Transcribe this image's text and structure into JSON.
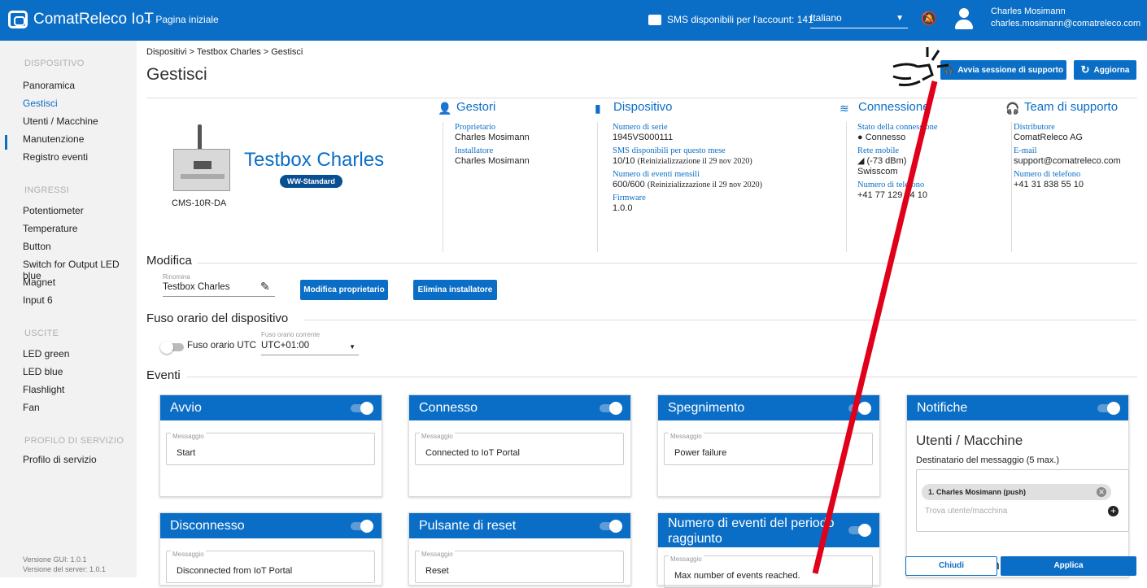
{
  "app": {
    "name": "ComatReleco IoT",
    "home_link": "← Pagina iniziale",
    "sms_text": "SMS disponibili per l'account: 141",
    "language": "Italiano",
    "user_name": "Charles Mosimann",
    "user_email": "charles.mosimann@comatreleco.com"
  },
  "sidebar": {
    "sections": [
      {
        "title": "DISPOSITIVO",
        "items": [
          "Panoramica",
          "Gestisci",
          "Utenti / Macchine",
          "Manutenzione",
          "Registro eventi"
        ]
      },
      {
        "title": "INGRESSI",
        "items": [
          "Potentiometer",
          "Temperature",
          "Button",
          "Switch for Output LED blue",
          "Magnet",
          "Input 6"
        ]
      },
      {
        "title": "USCITE",
        "items": [
          "LED green",
          "LED blue",
          "Flashlight",
          "Fan"
        ]
      },
      {
        "title": "PROFILO DI SERVIZIO",
        "items": [
          "Profilo di servizio"
        ]
      }
    ],
    "active_item": "Gestisci",
    "version_gui": "Versione GUI: 1.0.1",
    "version_server": "Versione del server: 1.0.1"
  },
  "header": {
    "breadcrumb": "Dispositivi > Testbox Charles > Gestisci",
    "title": "Gestisci",
    "support_button": "Avvia sessione di supporto",
    "refresh_button": "Aggiorna"
  },
  "device": {
    "model": "CMS-10R-DA",
    "name": "Testbox Charles",
    "badge": "WW-Standard"
  },
  "info": {
    "managers": {
      "title": "Gestori",
      "rows": [
        {
          "k": "Proprietario",
          "v": "Charles Mosimann"
        },
        {
          "k": "Installatore",
          "v": "Charles Mosimann"
        }
      ]
    },
    "device": {
      "title": "Dispositivo",
      "rows": [
        {
          "k": "Numero di serie",
          "v": "1945VS000111"
        },
        {
          "k": "SMS disponibili per questo mese",
          "v": "10/10",
          "n": "(Reinizializzazione il 29 nov 2020)"
        },
        {
          "k": "Numero di eventi mensili",
          "v": "600/600",
          "n": "(Reinizializzazione il 29 nov 2020)"
        },
        {
          "k": "Firmware",
          "v": "1.0.0"
        }
      ]
    },
    "connection": {
      "title": "Connessione",
      "rows": [
        {
          "k": "Stato della connessione",
          "v": "● Connesso"
        },
        {
          "k": "Rete mobile",
          "v": "◢ (-73 dBm)"
        },
        {
          "v": "Swisscom"
        },
        {
          "k": "Numero di telefono",
          "v": "+41 77 129 14 10"
        }
      ]
    },
    "support": {
      "title": "Team di supporto",
      "rows": [
        {
          "k": "Distributore",
          "v": "ComatReleco AG"
        },
        {
          "k": "E-mail",
          "v": "support@comatreleco.com"
        },
        {
          "k": "Numero di telefono",
          "v": "+41 31 838 55 10"
        }
      ]
    }
  },
  "modify": {
    "title": "Modifica",
    "rename_label": "Rinomina",
    "rename_value": "Testbox Charles",
    "owner_button": "Modifica proprietario",
    "installer_button": "Elimina installatore"
  },
  "timezone": {
    "title": "Fuso orario del dispositivo",
    "utc_label": "Fuso orario UTC",
    "current_label": "Fuso orario corrente",
    "current_value": "UTC+01:00"
  },
  "events": {
    "title": "Eventi",
    "cards": [
      {
        "title": "Avvio",
        "label": "Messaggio",
        "message": "Start"
      },
      {
        "title": "Connesso",
        "label": "Messaggio",
        "message": "Connected to IoT Portal"
      },
      {
        "title": "Spegnimento",
        "label": "Messaggio",
        "message": "Power failure"
      },
      {
        "title": "Disconnesso",
        "label": "Messaggio",
        "message": "Disconnected from IoT Portal"
      },
      {
        "title": "Pulsante di reset",
        "label": "Messaggio",
        "message": "Reset"
      },
      {
        "title": "Numero di eventi del periodo raggiunto",
        "label": "Messaggio",
        "message": "Max number of events reached."
      }
    ]
  },
  "notifications": {
    "title": "Notifiche",
    "subtitle": "Utenti / Macchine",
    "recipient_label": "Destinatario del messaggio (5 max.)",
    "recipient": "1. Charles Mosimann  (push)",
    "search_placeholder": "Trova utente/macchina",
    "hidden_word": "on",
    "close_button": "Chiudi",
    "apply_button": "Applica"
  },
  "colors": {
    "primary": "#0b6ec6",
    "annotation_arrow": "#e0001a"
  }
}
